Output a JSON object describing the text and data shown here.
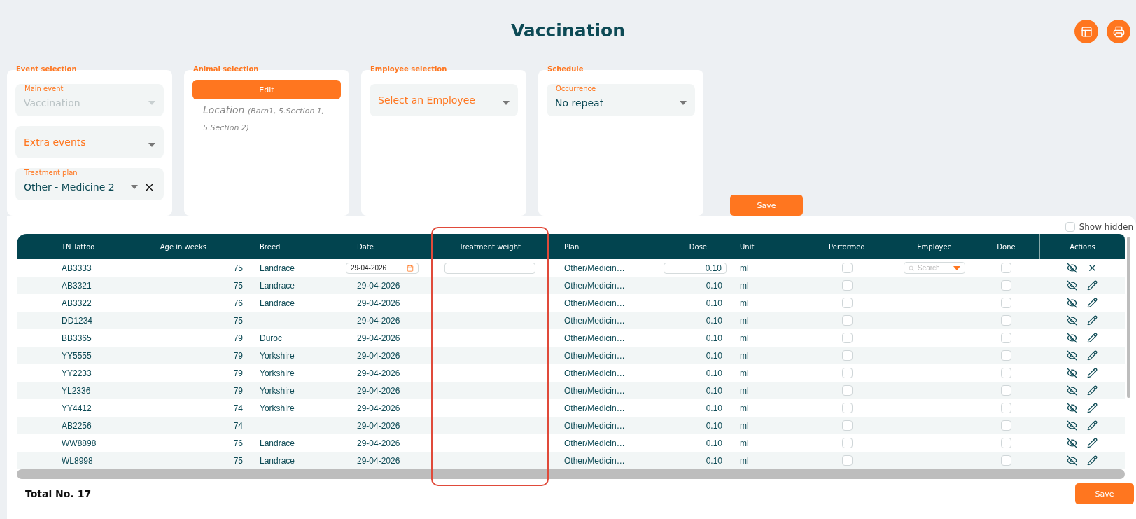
{
  "page": {
    "title": "Vaccination"
  },
  "header_buttons": [
    {
      "kind": "columns"
    },
    {
      "kind": "print"
    }
  ],
  "panels": [
    {
      "kind": "fields",
      "title": "Event selection",
      "fields": [
        {
          "label": "Main event",
          "value": "Vaccination",
          "disabled": true
        },
        {
          "placeholder": "Extra events",
          "disabled": false
        },
        {
          "label": "Treatment plan",
          "value": "Other - Medicine 2",
          "disabled": false,
          "clearable": true
        }
      ]
    },
    {
      "kind": "animal",
      "title": "Animal selection",
      "button": "Edit",
      "location": "Location",
      "location_detail": "(Barn1, 5.Section 1, 5.Section 2)"
    },
    {
      "kind": "fields",
      "title": "Employee selection",
      "fields": [
        {
          "placeholder": "Select an Employee",
          "disabled": false
        }
      ]
    },
    {
      "kind": "fields",
      "title": "Schedule",
      "fields": [
        {
          "label": "Occurrence",
          "value": "No repeat",
          "disabled": false
        }
      ]
    }
  ],
  "save_button": "Save",
  "show_hidden": {
    "label": "Show hidden",
    "checked": false
  },
  "table": {
    "columns": [
      {
        "label": "TN Tattoo",
        "kind": "text",
        "highlighted": false
      },
      {
        "label": "Age in weeks",
        "kind": "number",
        "highlighted": false
      },
      {
        "label": "Breed",
        "kind": "text",
        "highlighted": false
      },
      {
        "label": "Date",
        "kind": "date",
        "highlighted": false
      },
      {
        "label": "Treatment weight",
        "kind": "weight",
        "highlighted": true
      },
      {
        "label": "Plan",
        "kind": "text",
        "highlighted": false
      },
      {
        "label": "Dose",
        "kind": "dose",
        "highlighted": false
      },
      {
        "label": "Unit",
        "kind": "text",
        "highlighted": false
      },
      {
        "label": "Performed",
        "kind": "check",
        "highlighted": false
      },
      {
        "label": "Employee",
        "kind": "employee",
        "highlighted": false
      },
      {
        "label": "Done",
        "kind": "check",
        "highlighted": false
      },
      {
        "label": "Actions",
        "kind": "actions",
        "highlighted": false
      }
    ],
    "rows": [
      {
        "editing": true,
        "tattoo": "AB3333",
        "age": "75",
        "breed": "Landrace",
        "date": "29-04-2026",
        "plan": "Other/Medicin…",
        "dose": "0.10",
        "unit": "ml",
        "performed": false,
        "employee": "Search",
        "done": false
      },
      {
        "editing": false,
        "tattoo": "AB3321",
        "age": "75",
        "breed": "Landrace",
        "date": "29-04-2026",
        "plan": "Other/Medicin…",
        "dose": "0.10",
        "unit": "ml",
        "performed": false,
        "done": false
      },
      {
        "editing": false,
        "tattoo": "AB3322",
        "age": "76",
        "breed": "Landrace",
        "date": "29-04-2026",
        "plan": "Other/Medicin…",
        "dose": "0.10",
        "unit": "ml",
        "performed": false,
        "done": false
      },
      {
        "editing": false,
        "tattoo": "DD1234",
        "age": "75",
        "date": "29-04-2026",
        "plan": "Other/Medicin…",
        "dose": "0.10",
        "unit": "ml",
        "performed": false,
        "done": false
      },
      {
        "editing": false,
        "tattoo": "BB3365",
        "age": "79",
        "breed": "Duroc",
        "date": "29-04-2026",
        "plan": "Other/Medicin…",
        "dose": "0.10",
        "unit": "ml",
        "performed": false,
        "done": false
      },
      {
        "editing": false,
        "tattoo": "YY5555",
        "age": "79",
        "breed": "Yorkshire",
        "date": "29-04-2026",
        "plan": "Other/Medicin…",
        "dose": "0.10",
        "unit": "ml",
        "performed": false,
        "done": false
      },
      {
        "editing": false,
        "tattoo": "YY2233",
        "age": "79",
        "breed": "Yorkshire",
        "date": "29-04-2026",
        "plan": "Other/Medicin…",
        "dose": "0.10",
        "unit": "ml",
        "performed": false,
        "done": false
      },
      {
        "editing": false,
        "tattoo": "YL2336",
        "age": "79",
        "breed": "Yorkshire",
        "date": "29-04-2026",
        "plan": "Other/Medicin…",
        "dose": "0.10",
        "unit": "ml",
        "performed": false,
        "done": false
      },
      {
        "editing": false,
        "tattoo": "YY4412",
        "age": "74",
        "breed": "Yorkshire",
        "date": "29-04-2026",
        "plan": "Other/Medicin…",
        "dose": "0.10",
        "unit": "ml",
        "performed": false,
        "done": false
      },
      {
        "editing": false,
        "tattoo": "AB2256",
        "age": "74",
        "date": "29-04-2026",
        "plan": "Other/Medicin…",
        "dose": "0.10",
        "unit": "ml",
        "performed": false,
        "done": false
      },
      {
        "editing": false,
        "tattoo": "WW8898",
        "age": "76",
        "breed": "Landrace",
        "date": "29-04-2026",
        "plan": "Other/Medicin…",
        "dose": "0.10",
        "unit": "ml",
        "performed": false,
        "done": false
      },
      {
        "editing": false,
        "tattoo": "WL8998",
        "age": "75",
        "breed": "Landrace",
        "date": "29-04-2026",
        "plan": "Other/Medicin…",
        "dose": "0.10",
        "unit": "ml",
        "performed": false,
        "done": false
      }
    ]
  },
  "total": "Total No. 17",
  "bottom_save_button": "Save"
}
